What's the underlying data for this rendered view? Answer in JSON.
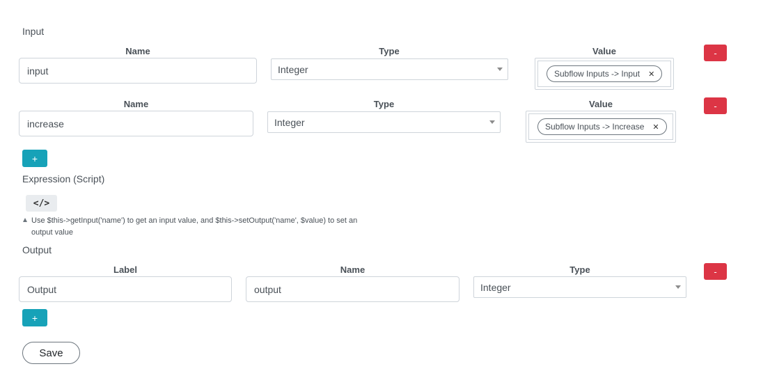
{
  "input_section": {
    "title": "Input",
    "rows": [
      {
        "name_label": "Name",
        "type_label": "Type",
        "value_label": "Value",
        "name_value": "input",
        "type_value": "Integer",
        "value_chip": "Subflow Inputs -> Input",
        "remove_label": "-"
      },
      {
        "name_label": "Name",
        "type_label": "Type",
        "value_label": "Value",
        "name_value": "increase",
        "type_value": "Integer",
        "value_chip": "Subflow Inputs -> Increase",
        "remove_label": "-"
      }
    ],
    "add_label": "+"
  },
  "expression_section": {
    "title": "Expression (Script)",
    "code_button_label": "</>",
    "help_line1": "Use $this->getInput('name') to get an input value, and $this->setOutput('name', $value) to set an",
    "help_line2": "output value"
  },
  "output_section": {
    "title": "Output",
    "rows": [
      {
        "label_label": "Label",
        "name_label": "Name",
        "type_label": "Type",
        "label_value": "Output",
        "name_value": "output",
        "type_value": "Integer",
        "remove_label": "-"
      }
    ],
    "add_label": "+"
  },
  "save_label": "Save",
  "colors": {
    "danger": "#dc3545",
    "info": "#17a2b8",
    "border": "#ced4da"
  }
}
